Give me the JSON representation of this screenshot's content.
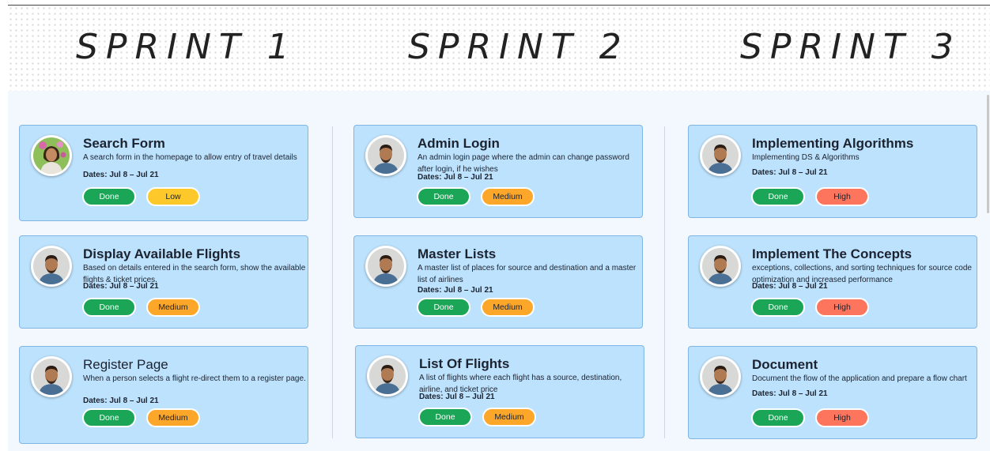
{
  "sprints": [
    {
      "title": "SPRINT 1",
      "cards": [
        {
          "title": "Search Form",
          "description": "A search form in the homepage to allow entry of travel details",
          "dates": "Dates: Jul 8 – Jul 21",
          "status": "Done",
          "priority": "Low",
          "avatar": "woman-portrait",
          "title_weight": "bold"
        },
        {
          "title": "Display Available Flights",
          "description": "Based on details entered in the search form, show the available flights &  ticket prices.",
          "dates": "Dates: Jul 8 – Jul 21",
          "status": "Done",
          "priority": "Medium",
          "avatar": "man-portrait",
          "title_weight": "bold"
        },
        {
          "title": "Register Page",
          "description": "When a person selects a flight re-direct them to a register page.",
          "dates": "Dates: Jul 8 – Jul 21",
          "status": "Done",
          "priority": "Medium",
          "avatar": "man-portrait",
          "title_weight": "normal"
        }
      ]
    },
    {
      "title": "SPRINT 2",
      "cards": [
        {
          "title": "Admin Login",
          "description": "An admin login page where the admin can change  password after login, if he wishes",
          "dates": "Dates: Jul 8 – Jul 21",
          "status": "Done",
          "priority": "Medium",
          "avatar": "man-portrait",
          "title_weight": "bold"
        },
        {
          "title": "Master Lists",
          "description": "A master list of places for source and destination and a master list of airlines",
          "dates": "Dates: Jul 8 – Jul 21",
          "status": "Done",
          "priority": "Medium",
          "avatar": "man-portrait",
          "title_weight": "bold"
        },
        {
          "title": "List Of Flights",
          "description": "A list of flights where each flight has a source, destination, airline, and ticket price",
          "dates": "Dates: Jul 8 – Jul 21",
          "status": "Done",
          "priority": "Medium",
          "avatar": "man-portrait",
          "title_weight": "bold"
        }
      ]
    },
    {
      "title": "SPRINT 3",
      "cards": [
        {
          "title": "Implementing Algorithms",
          "description": "Implementing DS & Algorithms",
          "dates": "Dates: Jul 8 – Jul 21",
          "status": "Done",
          "priority": "High",
          "avatar": "man-portrait",
          "title_weight": "bold"
        },
        {
          "title": "Implement The Concepts",
          "description": "exceptions, collections, and sorting techniques for source code optimization and increased performance",
          "dates": "Dates: Jul 8 – Jul 21",
          "status": "Done",
          "priority": "High",
          "avatar": "man-portrait",
          "title_weight": "bold"
        },
        {
          "title": "Document",
          "description": "Document the flow of the application and prepare a flow chart",
          "dates": "Dates: Jul 8 – Jul 21",
          "status": "Done",
          "priority": "High",
          "avatar": "man-portrait",
          "title_weight": "bold"
        }
      ]
    }
  ],
  "colors": {
    "card_background": "#bde2fd",
    "card_border": "#7fb6e6",
    "board_background": "#f2f8fd",
    "done": "#1aa656",
    "low": "#fdc82a",
    "medium": "#fca72a",
    "high": "#fd755c"
  }
}
